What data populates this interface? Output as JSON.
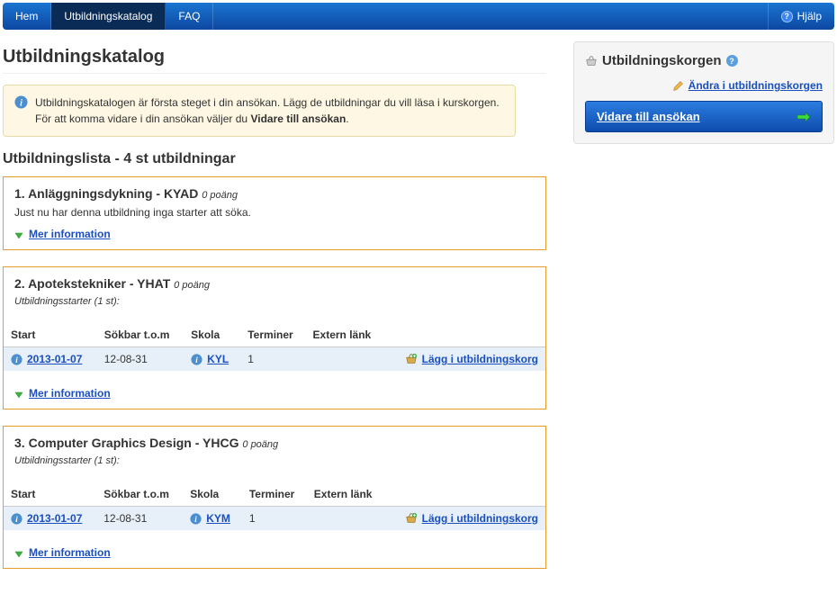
{
  "nav": {
    "home": "Hem",
    "catalog": "Utbildningskatalog",
    "faq": "FAQ",
    "help": "Hjälp"
  },
  "page_title": "Utbildningskatalog",
  "info_notice": {
    "pre": "Utbildningskatalogen är första steget i din ansökan. Lägg de utbildningar du vill läsa i kurskorgen. För att komma vidare i din ansökan väljer du ",
    "bold": "Vidare till ansökan",
    "post": "."
  },
  "list_heading": "Utbildningslista - 4 st utbildningar",
  "labels": {
    "more_info": "Mer information",
    "starts_header_prefix": "Utbildningsstarter",
    "add_to_basket": "Lägg i utbildningskorg",
    "points_suffix": "poäng"
  },
  "columns": {
    "start": "Start",
    "sokbar": "Sökbar t.o.m",
    "skola": "Skola",
    "terminer": "Terminer",
    "extern": "Extern länk"
  },
  "courses": [
    {
      "idx": "1.",
      "title": "Anläggningsdykning - KYAD",
      "points": "0",
      "no_starts_msg": "Just nu har denna utbildning inga starter att söka."
    },
    {
      "idx": "2.",
      "title": "Apotekstekniker - YHAT",
      "points": "0",
      "starts_count": "(1 st)",
      "rows": [
        {
          "start": "2013-01-07",
          "sokbar": "12-08-31",
          "skola": "KYL",
          "terminer": "1"
        }
      ]
    },
    {
      "idx": "3.",
      "title": "Computer Graphics Design - YHCG",
      "points": "0",
      "starts_count": "(1 st)",
      "rows": [
        {
          "start": "2013-01-07",
          "sokbar": "12-08-31",
          "skola": "KYM",
          "terminer": "1"
        }
      ]
    }
  ],
  "sidebar": {
    "title": "Utbildningskorgen",
    "edit_link": "Ändra i utbildningskorgen",
    "proceed": "Vidare till ansökan"
  }
}
